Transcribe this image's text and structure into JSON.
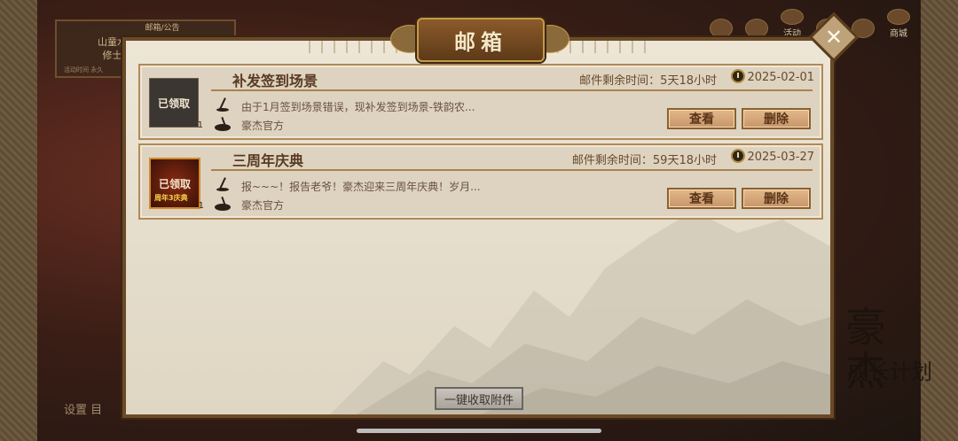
{
  "background": {
    "sign_title": "邮箱/公告",
    "sign_text": "山童水更\n修士牛",
    "sign_small": "活动时间 永久",
    "top_icons": [
      {
        "label": "",
        "icon": "diamond-icon"
      },
      {
        "label": "",
        "icon": "event-icon"
      },
      {
        "label": "活动",
        "icon": "activity-icon"
      },
      {
        "label": "",
        "icon": "gift-icon"
      },
      {
        "label": "",
        "icon": "rank-icon"
      },
      {
        "label": "商城",
        "icon": "shop-icon"
      }
    ],
    "bottom_left": "设置 目",
    "calligraphy": "豪杰",
    "calligraphy_small": "成长计划"
  },
  "dialog": {
    "title": "邮箱",
    "close_icon": "close-icon",
    "collect_all_label": "一键收取附件"
  },
  "mails": [
    {
      "title": "补发签到场景",
      "remain_label": "邮件剩余时间：5天18小时",
      "date": "2025-02-01",
      "thumb_label": "已领取",
      "thumb_sub": "",
      "thumb_count": "1",
      "preview": "由于1月签到场景错误，现补发签到场景-铁韵农...",
      "sender": "豪杰官方",
      "view_label": "查看",
      "delete_label": "删除"
    },
    {
      "title": "三周年庆典",
      "remain_label": "邮件剩余时间：59天18小时",
      "date": "2025-03-27",
      "thumb_label": "已领取",
      "thumb_sub": "周年3庆典",
      "thumb_count": "1",
      "preview": "报~~~！报告老爷！豪杰迎来三周年庆典！岁月...",
      "sender": "豪杰官方",
      "view_label": "查看",
      "delete_label": "删除"
    }
  ]
}
